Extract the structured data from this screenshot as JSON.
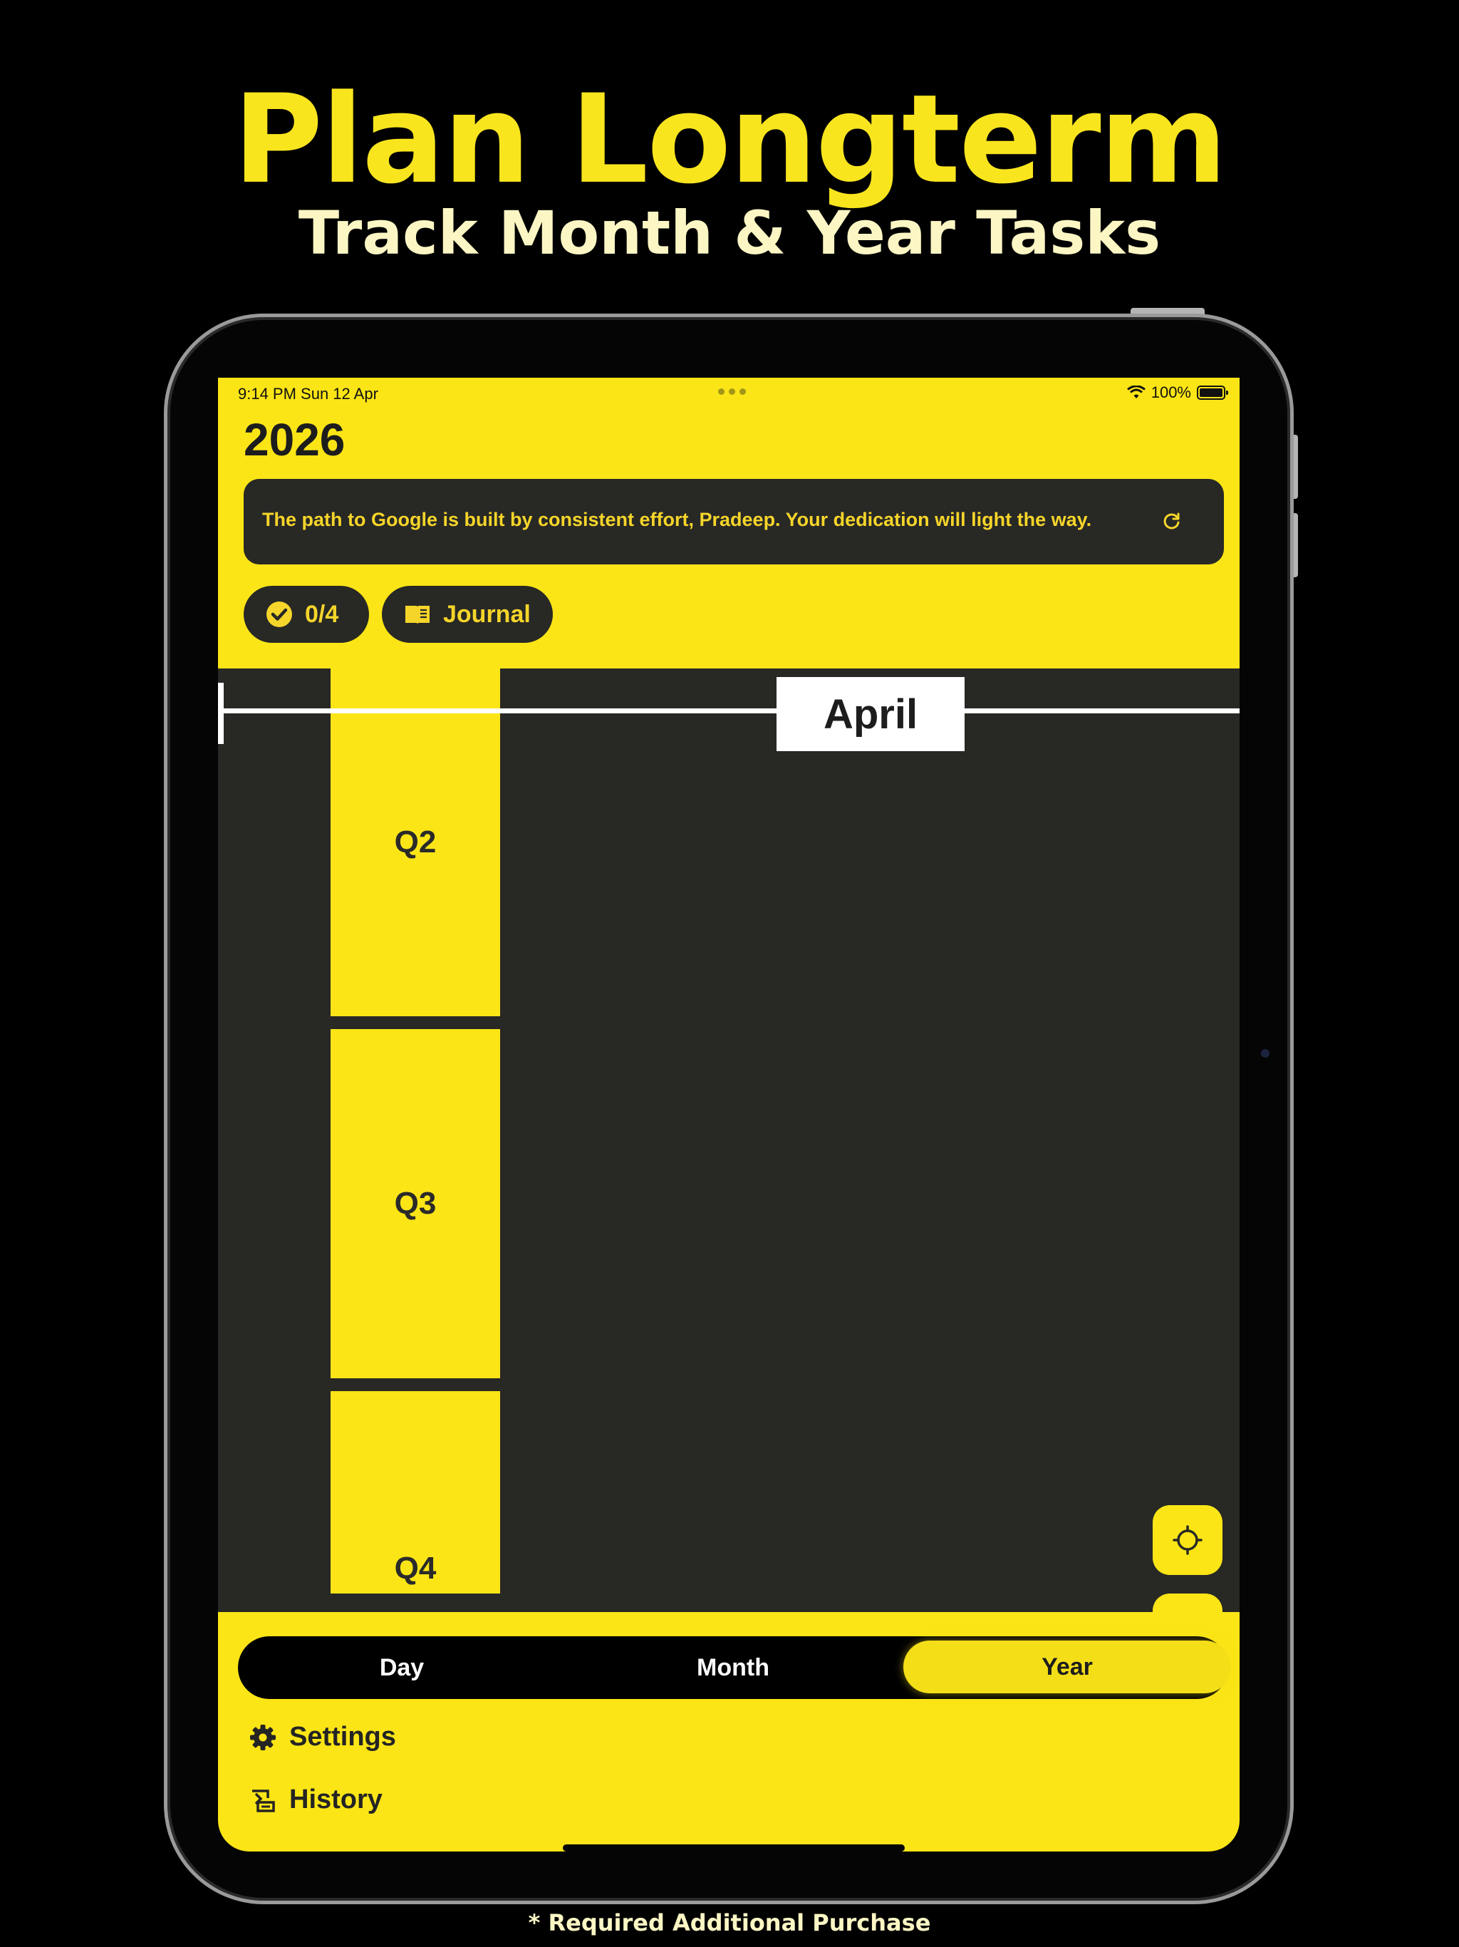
{
  "marketing": {
    "headline": "Plan Longterm",
    "subheadline": "Track Month & Year Tasks",
    "footnote": "* Required Additional Purchase"
  },
  "status_bar": {
    "time_date": "9:14 PM   Sun 12 Apr",
    "battery": "100%"
  },
  "header": {
    "year": "2026",
    "quote": "The path to Google is built by consistent effort, Pradeep. Your dedication will light the way."
  },
  "pills": {
    "progress": "0/4",
    "journal": "Journal"
  },
  "timeline": {
    "current_month": "April",
    "quarters": [
      "Q2",
      "Q3",
      "Q4"
    ]
  },
  "view_switch": {
    "day": "Day",
    "month": "Month",
    "year": "Year",
    "selected": "Year"
  },
  "menu": {
    "settings": "Settings",
    "history": "History"
  },
  "colors": {
    "accent": "#FBE516",
    "dark": "#282825",
    "background": "#000000"
  }
}
